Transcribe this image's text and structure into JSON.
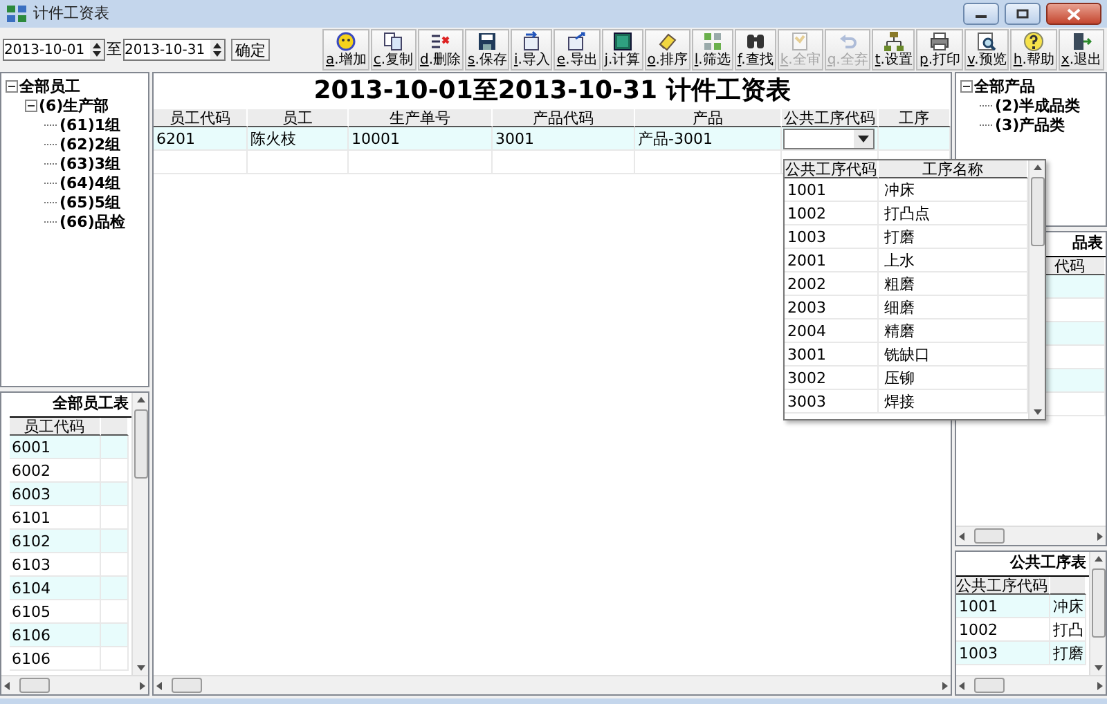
{
  "window": {
    "title": "计件工资表"
  },
  "date_range": {
    "from": "2013-10-01",
    "separator": "至",
    "to": "2013-10-31",
    "confirm": "确定"
  },
  "toolbar": [
    {
      "label": "a.增加",
      "disabled": false
    },
    {
      "label": "c.复制",
      "disabled": false
    },
    {
      "label": "d.删除",
      "disabled": false
    },
    {
      "label": "s.保存",
      "disabled": false
    },
    {
      "label": "i.导入",
      "disabled": false
    },
    {
      "label": "e.导出",
      "disabled": false
    },
    {
      "label": "j.计算",
      "disabled": false
    },
    {
      "label": "o.排序",
      "disabled": false
    },
    {
      "label": "l.筛选",
      "disabled": false
    },
    {
      "label": "f.查找",
      "disabled": false
    },
    {
      "label": "k.全审",
      "disabled": true
    },
    {
      "label": "q.全弃",
      "disabled": true
    },
    {
      "label": "t.设置",
      "disabled": false
    },
    {
      "label": "p.打印",
      "disabled": false
    },
    {
      "label": "v.预览",
      "disabled": false
    },
    {
      "label": "h.帮助",
      "disabled": false
    },
    {
      "label": "x.退出",
      "disabled": false
    }
  ],
  "employee_tree": {
    "label": "全部员工",
    "expanded": true,
    "children": [
      {
        "label": "(6)生产部",
        "expanded": true,
        "children": [
          {
            "label": "(61)1组"
          },
          {
            "label": "(62)2组"
          },
          {
            "label": "(63)3组"
          },
          {
            "label": "(64)4组"
          },
          {
            "label": "(65)5组"
          },
          {
            "label": "(66)品检"
          }
        ]
      }
    ]
  },
  "employee_table": {
    "title": "全部员工表",
    "columns": [
      "员工代码"
    ],
    "rows": [
      "6001",
      "6002",
      "6003",
      "6101",
      "6102",
      "6103",
      "6104",
      "6105",
      "6106",
      "6106"
    ]
  },
  "sheet": {
    "title": "2013-10-01至2013-10-31 计件工资表",
    "columns": [
      "员工代码",
      "员工",
      "生产单号",
      "产品代码",
      "产品",
      "公共工序代码",
      "工序"
    ],
    "rows": [
      [
        {
          "text": "6201"
        },
        {
          "text": "陈火枝"
        },
        {
          "text": "10001"
        },
        {
          "text": "3001"
        },
        {
          "text": "产品-3001"
        },
        {
          "kind": "combo"
        }
      ]
    ]
  },
  "dropdown": {
    "columns": [
      "公共工序代码",
      "工序名称"
    ],
    "rows": [
      [
        "1001",
        "冲床"
      ],
      [
        "1002",
        "打凸点"
      ],
      [
        "1003",
        "打磨"
      ],
      [
        "2001",
        "上水"
      ],
      [
        "2002",
        "粗磨"
      ],
      [
        "2003",
        "细磨"
      ],
      [
        "2004",
        "精磨"
      ],
      [
        "3001",
        "铣缺口"
      ],
      [
        "3002",
        "压铆"
      ],
      [
        "3003",
        "焊接"
      ]
    ]
  },
  "product_tree": {
    "label": "全部产品",
    "expanded": true,
    "children": [
      {
        "label": "(2)半成品类"
      },
      {
        "label": "(3)产品类"
      }
    ]
  },
  "product_table": {
    "title": "品表",
    "columns": [
      "代码"
    ]
  },
  "process_table": {
    "title": "公共工序表",
    "columns": [
      "公共工序代码"
    ],
    "rows": [
      [
        "1001",
        "冲床"
      ],
      [
        "1002",
        "打凸"
      ],
      [
        "1003",
        "打磨"
      ]
    ]
  }
}
